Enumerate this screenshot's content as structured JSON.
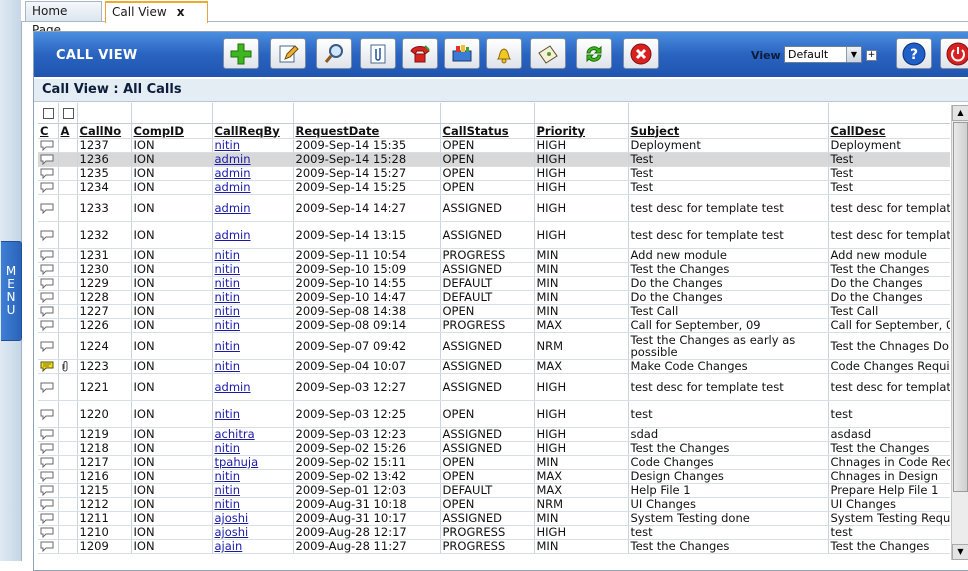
{
  "menu": {
    "label_letters": [
      "M",
      "E",
      "N",
      "U"
    ]
  },
  "tabs": [
    {
      "label": "Home Page",
      "active": false
    },
    {
      "label": "Call View",
      "active": true,
      "close": "x"
    }
  ],
  "toolbar": {
    "title": "CALL VIEW",
    "buttons": [
      {
        "name": "add-call-button",
        "icon": "green-plus-icon"
      },
      {
        "name": "edit-call-button",
        "icon": "pencil-icon"
      },
      {
        "name": "search-button",
        "icon": "magnifier-icon"
      },
      {
        "name": "attachment-button",
        "icon": "paperclip-icon"
      },
      {
        "name": "phone-button",
        "icon": "phone-icon"
      },
      {
        "name": "assign-button",
        "icon": "book-stack-icon"
      },
      {
        "name": "alert-button",
        "icon": "bell-icon"
      },
      {
        "name": "ticket-button",
        "icon": "ticket-icon"
      },
      {
        "name": "refresh-button",
        "icon": "refresh-icon"
      },
      {
        "name": "delete-button",
        "icon": "red-close-icon"
      }
    ],
    "view_label": "View",
    "view_value": "Default",
    "help_icon": "help-icon",
    "power_icon": "power-icon"
  },
  "subheader": {
    "title": "Call View : All Calls"
  },
  "grid": {
    "columns": [
      "C",
      "A",
      "CallNo",
      "CompID",
      "CallReqBy",
      "RequestDate",
      "CallStatus",
      "Priority",
      "Subject",
      "CallDesc"
    ],
    "rows": [
      {
        "callno": "1237",
        "comp": "ION",
        "by": "nitin",
        "date": "2009-Sep-14 15:35",
        "status": "OPEN",
        "priority": "HIGH",
        "subject": "Deployment",
        "desc": "Deployment"
      },
      {
        "callno": "1236",
        "comp": "ION",
        "by": "admin",
        "date": "2009-Sep-14 15:28",
        "status": "OPEN",
        "priority": "HIGH",
        "subject": "Test",
        "desc": "Test",
        "selected": true
      },
      {
        "callno": "1235",
        "comp": "ION",
        "by": "admin",
        "date": "2009-Sep-14 15:27",
        "status": "OPEN",
        "priority": "HIGH",
        "subject": "Test",
        "desc": "Test"
      },
      {
        "callno": "1234",
        "comp": "ION",
        "by": "admin",
        "date": "2009-Sep-14 15:25",
        "status": "OPEN",
        "priority": "HIGH",
        "subject": "Test",
        "desc": "Test"
      },
      {
        "callno": "1233",
        "comp": "ION",
        "by": "admin",
        "date": "2009-Sep-14 14:27",
        "status": "ASSIGNED",
        "priority": "HIGH",
        "subject": "test desc for template test",
        "desc": "test desc for template",
        "tall": true
      },
      {
        "callno": "1232",
        "comp": "ION",
        "by": "admin",
        "date": "2009-Sep-14 13:15",
        "status": "ASSIGNED",
        "priority": "HIGH",
        "subject": "test desc for template test",
        "desc": "test desc for template",
        "tall": true
      },
      {
        "callno": "1231",
        "comp": "ION",
        "by": "nitin",
        "date": "2009-Sep-11 10:54",
        "status": "PROGRESS",
        "priority": "MIN",
        "subject": "Add new module",
        "desc": "Add new module"
      },
      {
        "callno": "1230",
        "comp": "ION",
        "by": "nitin",
        "date": "2009-Sep-10 15:09",
        "status": "ASSIGNED",
        "priority": "MIN",
        "subject": "Test the Changes",
        "desc": "Test the Changes"
      },
      {
        "callno": "1229",
        "comp": "ION",
        "by": "nitin",
        "date": "2009-Sep-10 14:55",
        "status": "DEFAULT",
        "priority": "MIN",
        "subject": "Do the Changes",
        "desc": "Do the Changes"
      },
      {
        "callno": "1228",
        "comp": "ION",
        "by": "nitin",
        "date": "2009-Sep-10 14:47",
        "status": "DEFAULT",
        "priority": "MIN",
        "subject": "Do the Changes",
        "desc": "Do the Changes"
      },
      {
        "callno": "1227",
        "comp": "ION",
        "by": "nitin",
        "date": "2009-Sep-08 14:38",
        "status": "OPEN",
        "priority": "MIN",
        "subject": "Test Call",
        "desc": "Test Call"
      },
      {
        "callno": "1226",
        "comp": "ION",
        "by": "nitin",
        "date": "2009-Sep-08 09:14",
        "status": "PROGRESS",
        "priority": "MAX",
        "subject": "Call for September, 09",
        "desc": "Call for September, 0"
      },
      {
        "callno": "1224",
        "comp": "ION",
        "by": "nitin",
        "date": "2009-Sep-07 09:42",
        "status": "ASSIGNED",
        "priority": "NRM",
        "subject": "Test the Changes as early as possible",
        "desc": "Test the Chnages Do",
        "tall": true
      },
      {
        "callno": "1223",
        "comp": "ION",
        "by": "nitin",
        "date": "2009-Sep-04 10:07",
        "status": "ASSIGNED",
        "priority": "MAX",
        "subject": "Make Code Changes",
        "desc": "Code Changes Requi",
        "comment_flag": true,
        "attachment": true
      },
      {
        "callno": "1221",
        "comp": "ION",
        "by": "admin",
        "date": "2009-Sep-03 12:27",
        "status": "ASSIGNED",
        "priority": "HIGH",
        "subject": "test desc for template test",
        "desc": "test desc for template",
        "tall": true
      },
      {
        "callno": "1220",
        "comp": "ION",
        "by": "nitin",
        "date": "2009-Sep-03 12:25",
        "status": "OPEN",
        "priority": "HIGH",
        "subject": "test",
        "desc": "test",
        "tall2": true
      },
      {
        "callno": "1219",
        "comp": "ION",
        "by": "achitra",
        "date": "2009-Sep-03 12:23",
        "status": "ASSIGNED",
        "priority": "HIGH",
        "subject": "sdad",
        "desc": "asdasd"
      },
      {
        "callno": "1218",
        "comp": "ION",
        "by": "nitin",
        "date": "2009-Sep-02 15:26",
        "status": "ASSIGNED",
        "priority": "HIGH",
        "subject": "Test the Changes",
        "desc": "Test the Changes"
      },
      {
        "callno": "1217",
        "comp": "ION",
        "by": "tpahuja",
        "date": "2009-Sep-02 15:11",
        "status": "OPEN",
        "priority": "MIN",
        "subject": "Code Changes",
        "desc": "Chnages in Code Rec"
      },
      {
        "callno": "1216",
        "comp": "ION",
        "by": "nitin",
        "date": "2009-Sep-02 13:42",
        "status": "OPEN",
        "priority": "MAX",
        "subject": "Design Changes",
        "desc": "Chnages in Design"
      },
      {
        "callno": "1215",
        "comp": "ION",
        "by": "nitin",
        "date": "2009-Sep-01 12:03",
        "status": "DEFAULT",
        "priority": "MAX",
        "subject": "Help File 1",
        "desc": "Prepare Help File 1"
      },
      {
        "callno": "1212",
        "comp": "ION",
        "by": "nitin",
        "date": "2009-Aug-31 10:18",
        "status": "OPEN",
        "priority": "NRM",
        "subject": "UI Changes",
        "desc": "UI Changes"
      },
      {
        "callno": "1211",
        "comp": "ION",
        "by": "ajoshi",
        "date": "2009-Aug-31 10:17",
        "status": "ASSIGNED",
        "priority": "MIN",
        "subject": "System Testing done",
        "desc": "System Testing Requ"
      },
      {
        "callno": "1210",
        "comp": "ION",
        "by": "ajoshi",
        "date": "2009-Aug-28 12:17",
        "status": "PROGRESS",
        "priority": "HIGH",
        "subject": "test",
        "desc": "test"
      },
      {
        "callno": "1209",
        "comp": "ION",
        "by": "ajain",
        "date": "2009-Aug-28 11:27",
        "status": "PROGRESS",
        "priority": "MIN",
        "subject": "Test the Changes",
        "desc": "Test the Changes"
      }
    ]
  }
}
